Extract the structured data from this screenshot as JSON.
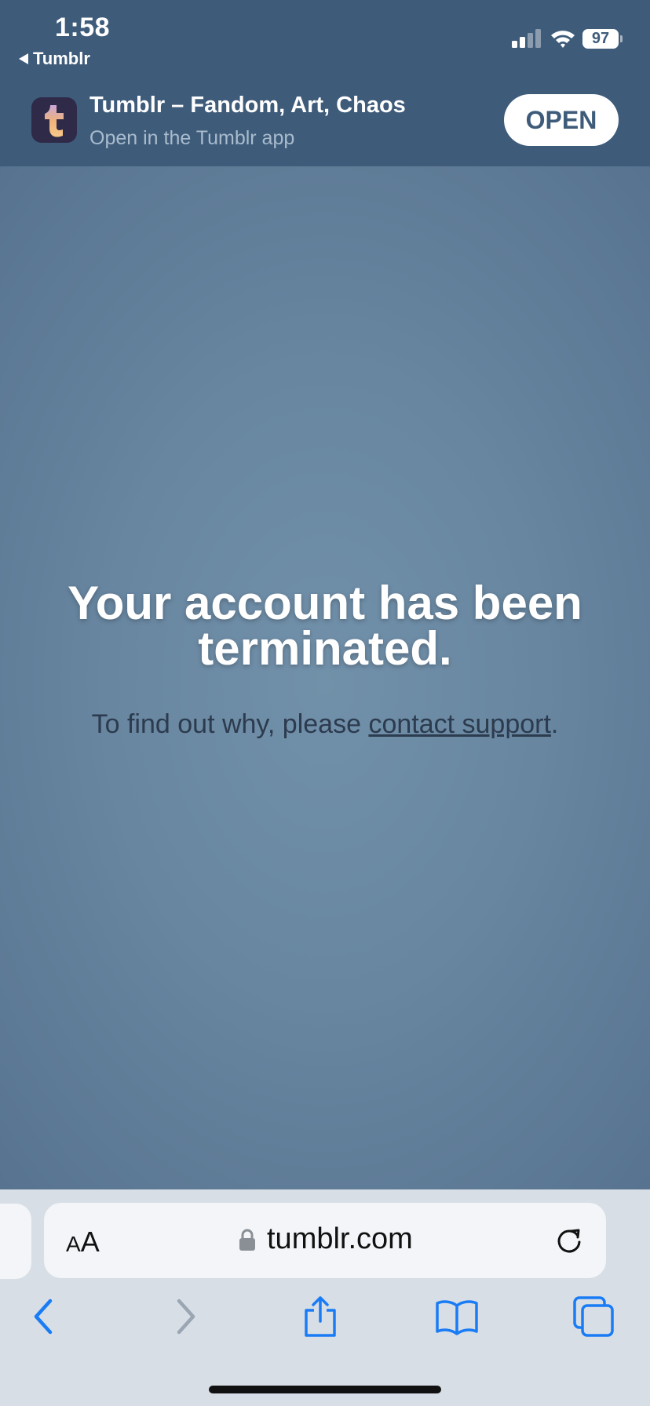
{
  "status": {
    "time": "1:58",
    "back_app": "Tumblr",
    "battery": "97"
  },
  "banner": {
    "app_name": "Tumblr – Fandom, Art, Chaos",
    "subtitle": "Open in the Tumblr app",
    "open_label": "OPEN"
  },
  "message": {
    "headline": "Your account has been terminated.",
    "sub_prefix": "To find out why, please ",
    "link_text": "contact support",
    "sub_suffix": "."
  },
  "browser": {
    "aa_label_small": "A",
    "aa_label_large": "A",
    "url": "tumblr.com"
  },
  "icons": {
    "back": "chevron-left-icon",
    "forward": "chevron-right-icon",
    "share": "share-icon",
    "bookmarks": "book-icon",
    "tabs": "tabs-icon"
  },
  "colors": {
    "accent": "#1a7cf5",
    "banner_bg": "#3e5b7a",
    "disabled": "#9aa6b3"
  }
}
